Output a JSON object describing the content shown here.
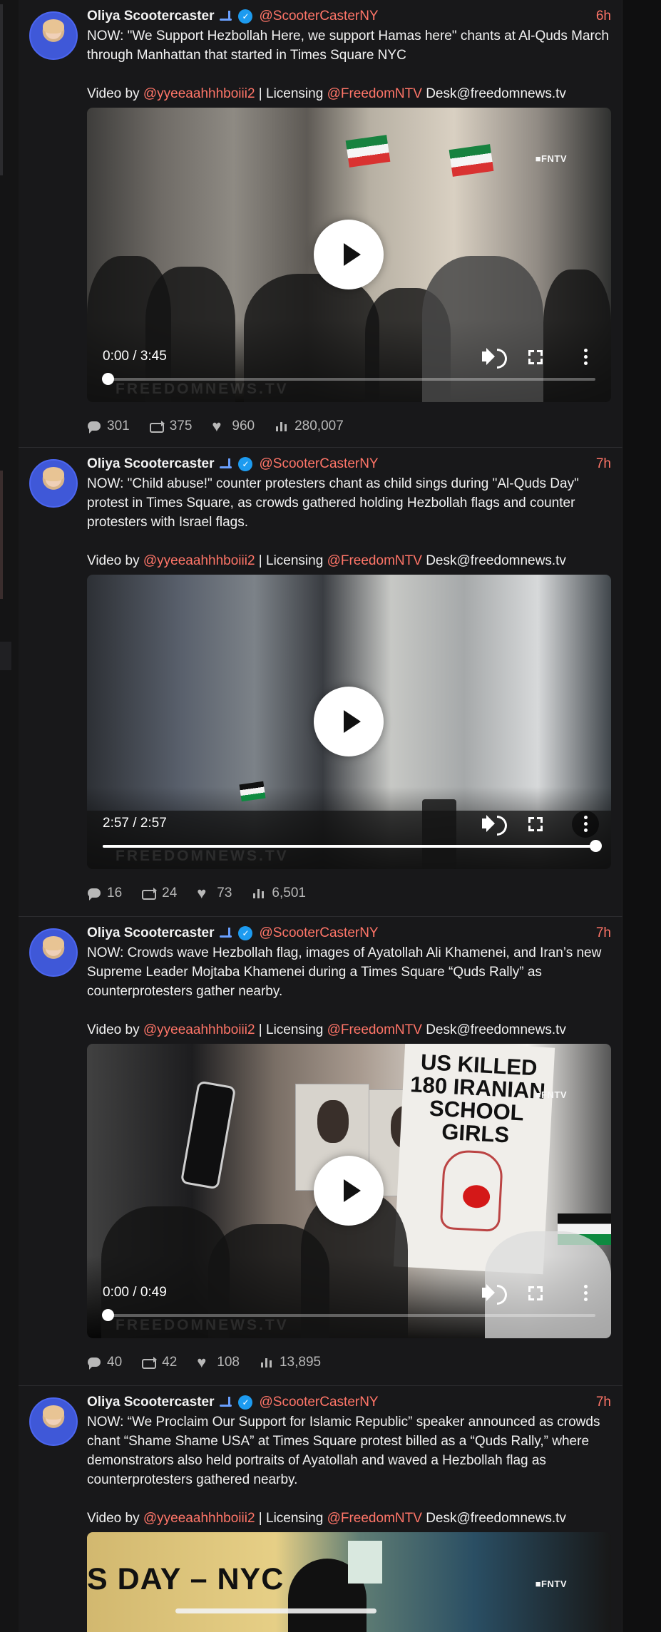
{
  "theme": {
    "background": "#111112",
    "feed_background": "#18181a",
    "accent": "#ff7568",
    "verified": "#1d9bf0"
  },
  "posts": [
    {
      "author": "Oliya Scootercaster",
      "handle": "@ScooterCasterNY",
      "time": "6h",
      "text": "NOW: \"We Support Hezbollah Here, we support Hamas here\" chants at Al-Quds March through Manhattan that started in Times Square NYC",
      "credit_prefix": "Video by",
      "video_user": "@yyeeaahhhboiii2",
      "licensing_label": "| Licensing",
      "licensing_user": "@FreedomNTV",
      "email": "Desk@freedomnews.tv",
      "video": {
        "timecode": "0:00 / 3:45",
        "progress": 0.01,
        "watermark": "■FNTV",
        "bottom_watermark": "FREEDOMNEWS.TV"
      },
      "stats": {
        "replies": "301",
        "reposts": "375",
        "likes": "960",
        "views": "280,007"
      }
    },
    {
      "author": "Oliya Scootercaster",
      "handle": "@ScooterCasterNY",
      "time": "7h",
      "text": "NOW: \"Child abuse!\" counter protesters chant as child sings during \"Al-Quds Day\" protest in Times Square, as crowds gathered holding Hezbollah flags and counter protesters with Israel flags.",
      "credit_prefix": "Video by",
      "video_user": "@yyeeaahhhboiii2",
      "licensing_label": "| Licensing",
      "licensing_user": "@FreedomNTV",
      "email": "Desk@freedomnews.tv",
      "video": {
        "timecode": "2:57 / 2:57",
        "progress": 1,
        "watermark": "",
        "bottom_watermark": "FREEDOMNEWS.TV"
      },
      "stats": {
        "replies": "16",
        "reposts": "24",
        "likes": "73",
        "views": "6,501"
      }
    },
    {
      "author": "Oliya Scootercaster",
      "handle": "@ScooterCasterNY",
      "time": "7h",
      "text": "NOW: Crowds wave Hezbollah flag, images of Ayatollah Ali Khamenei, and Iran’s new Supreme Leader Mojtaba Khamenei during a Times Square “Quds Rally” as counterprotesters gather nearby.",
      "credit_prefix": "Video by",
      "video_user": "@yyeeaahhhboiii2",
      "licensing_label": "| Licensing",
      "licensing_user": "@FreedomNTV",
      "email": "Desk@freedomnews.tv",
      "video": {
        "timecode": "0:00 / 0:49",
        "progress": 0.01,
        "watermark": "■FNTV",
        "bottom_watermark": "FREEDOMNEWS.TV",
        "sign_text": "US KILLED 180 IRANIAN SCHOOL GIRLS"
      },
      "stats": {
        "replies": "40",
        "reposts": "42",
        "likes": "108",
        "views": "13,895"
      }
    },
    {
      "author": "Oliya Scootercaster",
      "handle": "@ScooterCasterNY",
      "time": "7h",
      "text": "NOW: “We Proclaim Our Support for Islamic Republic” speaker announced as crowds chant “Shame Shame USA” at Times Square protest billed as a “Quds Rally,” where demonstrators also held portraits of Ayatollah and waved a Hezbollah flag as counterprotesters gathered nearby.",
      "credit_prefix": "Video by",
      "video_user": "@yyeeaahhhboiii2",
      "licensing_label": "| Licensing",
      "licensing_user": "@FreedomNTV",
      "email": "Desk@freedomnews.tv",
      "video": {
        "watermark": "■FNTV",
        "banner_text": "S DAY – NYC"
      }
    }
  ],
  "icons": {
    "reply": "reply-icon",
    "repost": "repost-icon",
    "like": "like-icon",
    "views": "views-icon",
    "play": "play-icon",
    "volume": "volume-icon",
    "fullscreen": "fullscreen-icon",
    "more": "more-icon"
  }
}
